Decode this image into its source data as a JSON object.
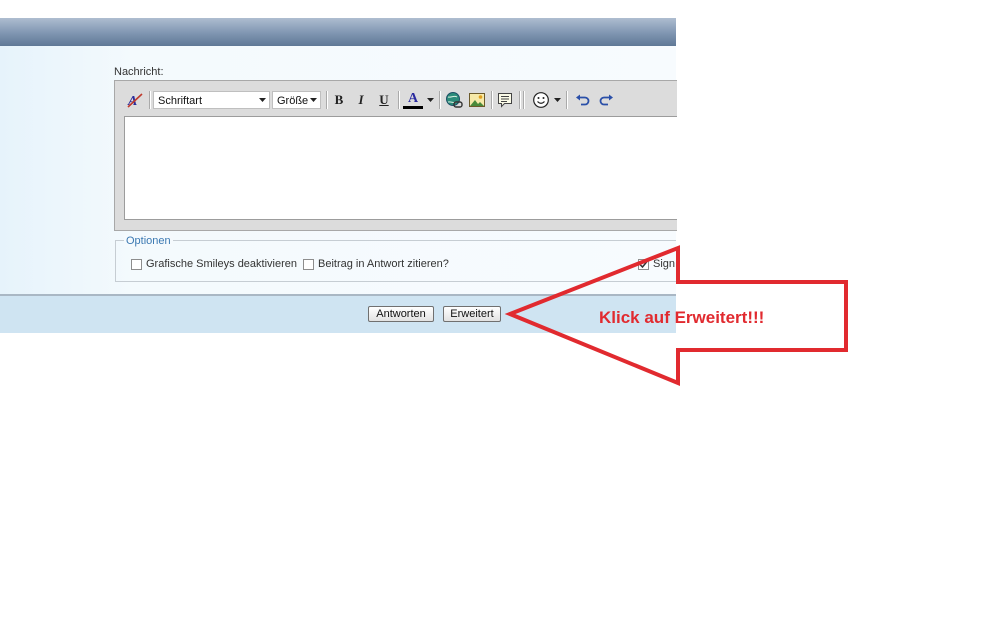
{
  "editor": {
    "message_label": "Nachricht:",
    "font_select": "Schriftart",
    "size_select": "Größe",
    "bold_label": "B",
    "italic_label": "I",
    "underline_label": "U",
    "color_label": "A"
  },
  "options": {
    "legend": "Optionen",
    "disable_smileys": "Grafische Smileys deaktivieren",
    "quote_post": "Beitrag in Antwort zitieren?",
    "signature": "Sign"
  },
  "footer": {
    "reply_button": "Antworten",
    "advanced_button": "Erweitert"
  },
  "annotation": {
    "callout_text": "Klick auf Erweitert!!!",
    "color": "#e12a2f"
  },
  "colors": {
    "header_gradient_dark": "#5f7896",
    "footer_bg": "#cfe4f2",
    "legend_text": "#3b79b2"
  }
}
